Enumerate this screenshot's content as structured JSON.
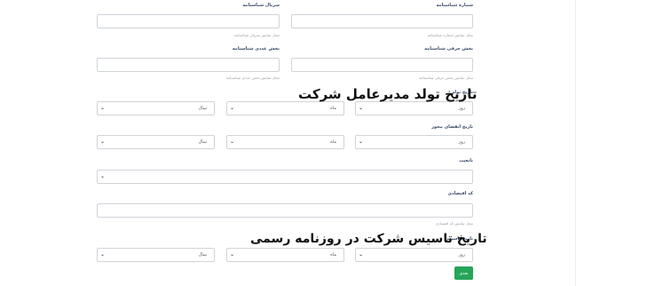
{
  "form": {
    "row1": {
      "right_label": "شماره شناسنامه",
      "right_hint": "محل نمایش شماره شناسنامه",
      "left_label": "سریال شناسنامه",
      "left_hint": "محل نمایش سریال شناسنامه"
    },
    "row2": {
      "right_label": "بخش حرفی شناسنامه",
      "right_hint": "محل نمایش بخش حرفی شناسنامه",
      "left_label": "بخش عددی شناسنامه",
      "left_hint": "محل نمایش بخش عددی شناسنامه"
    },
    "birth": {
      "label": "تاریخ تولد",
      "day": "روز",
      "month": "ماه",
      "year": "سال"
    },
    "license_expiry": {
      "label": "تاریخ انقضای مجوز",
      "day": "روز",
      "month": "ماه",
      "year": "سال"
    },
    "nationality": {
      "label": "تابعیت"
    },
    "economic_code": {
      "label": "کد اقتصادی",
      "hint": "محل نمایش کد اقتصادی"
    },
    "establishment": {
      "label": "تاریخ تاسیس",
      "day": "روز",
      "month": "ماه",
      "year": "سال"
    },
    "next_button": "بعدی"
  },
  "overlays": {
    "ceo_birth": "تاریخ تولد مدیرعامل شرکت",
    "company_establishment": "تاریخ تاسیس شرکت در روزنامه رسمی"
  },
  "icons": {
    "select_arrow": "chevron-down-icon"
  },
  "colors": {
    "accent": "#25a55a",
    "border": "#cfd4da",
    "label": "#3a4a6b"
  }
}
